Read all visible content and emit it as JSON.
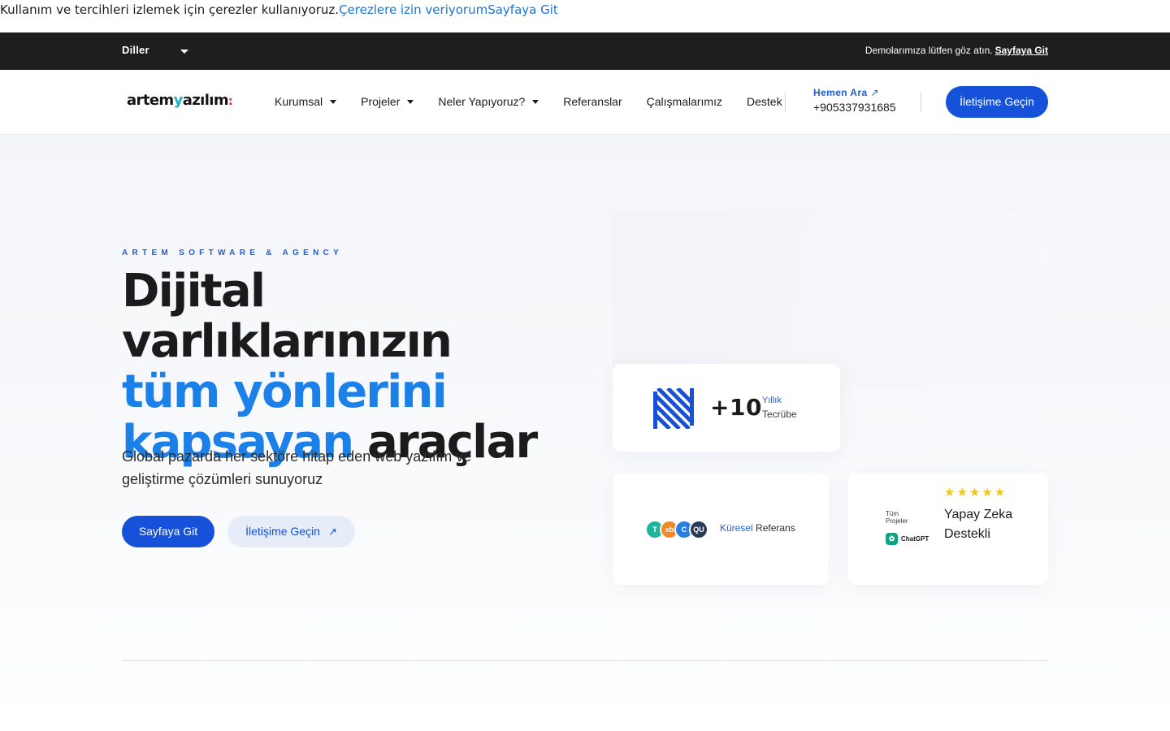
{
  "cookie": {
    "text": "Kullanım ve tercihleri izlemek için çerezler kullanıyoruz.",
    "accept": "Çerezlere izin veriyorum",
    "link": "Sayfaya Git"
  },
  "topbar": {
    "language": "Diller",
    "demo_text": "Demolarımıza lütfen göz atın.",
    "demo_link": "Sayfaya Git"
  },
  "nav": {
    "logo": {
      "part1": "artem",
      "part2": "y",
      "part3": "azılım",
      "part4": ":"
    },
    "items": [
      {
        "label": "Kurumsal",
        "dropdown": true
      },
      {
        "label": "Projeler",
        "dropdown": true
      },
      {
        "label": "Neler Yapıyoruz?",
        "dropdown": true
      },
      {
        "label": "Referanslar",
        "dropdown": false
      },
      {
        "label": "Çalışmalarımız",
        "dropdown": false
      },
      {
        "label": "Destek",
        "dropdown": false
      }
    ],
    "call_label": "Hemen Ara",
    "phone": "+905337931685",
    "contact_button": "İletişime Geçin"
  },
  "hero": {
    "eyebrow": "ARTEM SOFTWARE & AGENCY",
    "title_line1": "Dijital varlıklarınızın",
    "title_line2": "tüm yönlerini",
    "title_line3_blue": "kapsayan",
    "title_line3_dark": "araçlar",
    "lede": "Global pazarda her sektöre hitap eden web yazılım ve geliştirme çözümleri sunuyoruz",
    "primary_button": "Sayfaya Git",
    "secondary_button": "İletişime Geçin"
  },
  "cards": {
    "experience": {
      "number": "+10",
      "label1": "Yıllık",
      "label2": "Tecrübe"
    },
    "references": {
      "label_blue": "Küresel",
      "label_dark": "Referans",
      "avatars": [
        {
          "text": "T",
          "color": "#1fb39a"
        },
        {
          "text": "xb",
          "color": "#f08a24"
        },
        {
          "text": "C",
          "color": "#2a7de1"
        },
        {
          "text": "QU",
          "color": "#2e3a59"
        }
      ]
    },
    "ai": {
      "stars": "★★★★★",
      "small_line1": "Tüm",
      "small_line2": "Projeler",
      "gpt_label": "ChatGPT",
      "text": "Yapay Zeka Destekli"
    }
  },
  "colors": {
    "primary": "#1652d9",
    "accent_blue": "#1b80e8",
    "dark_bar": "#1e1e1e"
  }
}
